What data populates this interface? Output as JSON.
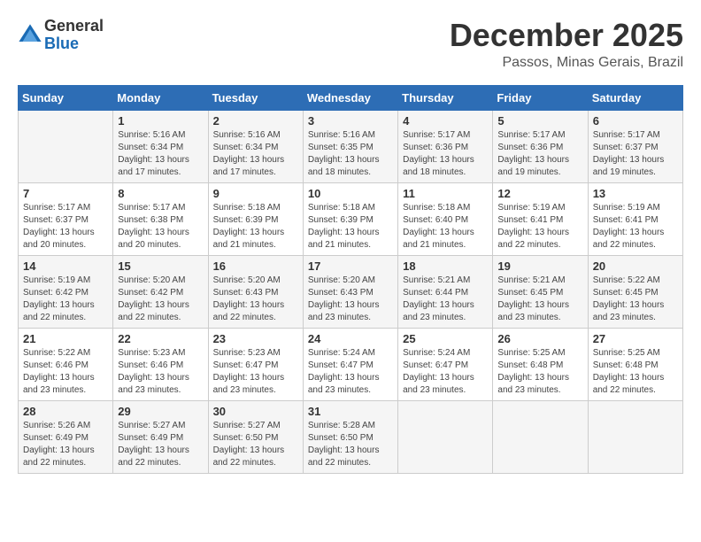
{
  "logo": {
    "general": "General",
    "blue": "Blue"
  },
  "title": "December 2025",
  "location": "Passos, Minas Gerais, Brazil",
  "days_of_week": [
    "Sunday",
    "Monday",
    "Tuesday",
    "Wednesday",
    "Thursday",
    "Friday",
    "Saturday"
  ],
  "weeks": [
    [
      {
        "day": "",
        "info": ""
      },
      {
        "day": "1",
        "info": "Sunrise: 5:16 AM\nSunset: 6:34 PM\nDaylight: 13 hours\nand 17 minutes."
      },
      {
        "day": "2",
        "info": "Sunrise: 5:16 AM\nSunset: 6:34 PM\nDaylight: 13 hours\nand 17 minutes."
      },
      {
        "day": "3",
        "info": "Sunrise: 5:16 AM\nSunset: 6:35 PM\nDaylight: 13 hours\nand 18 minutes."
      },
      {
        "day": "4",
        "info": "Sunrise: 5:17 AM\nSunset: 6:36 PM\nDaylight: 13 hours\nand 18 minutes."
      },
      {
        "day": "5",
        "info": "Sunrise: 5:17 AM\nSunset: 6:36 PM\nDaylight: 13 hours\nand 19 minutes."
      },
      {
        "day": "6",
        "info": "Sunrise: 5:17 AM\nSunset: 6:37 PM\nDaylight: 13 hours\nand 19 minutes."
      }
    ],
    [
      {
        "day": "7",
        "info": "Sunrise: 5:17 AM\nSunset: 6:37 PM\nDaylight: 13 hours\nand 20 minutes."
      },
      {
        "day": "8",
        "info": "Sunrise: 5:17 AM\nSunset: 6:38 PM\nDaylight: 13 hours\nand 20 minutes."
      },
      {
        "day": "9",
        "info": "Sunrise: 5:18 AM\nSunset: 6:39 PM\nDaylight: 13 hours\nand 21 minutes."
      },
      {
        "day": "10",
        "info": "Sunrise: 5:18 AM\nSunset: 6:39 PM\nDaylight: 13 hours\nand 21 minutes."
      },
      {
        "day": "11",
        "info": "Sunrise: 5:18 AM\nSunset: 6:40 PM\nDaylight: 13 hours\nand 21 minutes."
      },
      {
        "day": "12",
        "info": "Sunrise: 5:19 AM\nSunset: 6:41 PM\nDaylight: 13 hours\nand 22 minutes."
      },
      {
        "day": "13",
        "info": "Sunrise: 5:19 AM\nSunset: 6:41 PM\nDaylight: 13 hours\nand 22 minutes."
      }
    ],
    [
      {
        "day": "14",
        "info": "Sunrise: 5:19 AM\nSunset: 6:42 PM\nDaylight: 13 hours\nand 22 minutes."
      },
      {
        "day": "15",
        "info": "Sunrise: 5:20 AM\nSunset: 6:42 PM\nDaylight: 13 hours\nand 22 minutes."
      },
      {
        "day": "16",
        "info": "Sunrise: 5:20 AM\nSunset: 6:43 PM\nDaylight: 13 hours\nand 22 minutes."
      },
      {
        "day": "17",
        "info": "Sunrise: 5:20 AM\nSunset: 6:43 PM\nDaylight: 13 hours\nand 23 minutes."
      },
      {
        "day": "18",
        "info": "Sunrise: 5:21 AM\nSunset: 6:44 PM\nDaylight: 13 hours\nand 23 minutes."
      },
      {
        "day": "19",
        "info": "Sunrise: 5:21 AM\nSunset: 6:45 PM\nDaylight: 13 hours\nand 23 minutes."
      },
      {
        "day": "20",
        "info": "Sunrise: 5:22 AM\nSunset: 6:45 PM\nDaylight: 13 hours\nand 23 minutes."
      }
    ],
    [
      {
        "day": "21",
        "info": "Sunrise: 5:22 AM\nSunset: 6:46 PM\nDaylight: 13 hours\nand 23 minutes."
      },
      {
        "day": "22",
        "info": "Sunrise: 5:23 AM\nSunset: 6:46 PM\nDaylight: 13 hours\nand 23 minutes."
      },
      {
        "day": "23",
        "info": "Sunrise: 5:23 AM\nSunset: 6:47 PM\nDaylight: 13 hours\nand 23 minutes."
      },
      {
        "day": "24",
        "info": "Sunrise: 5:24 AM\nSunset: 6:47 PM\nDaylight: 13 hours\nand 23 minutes."
      },
      {
        "day": "25",
        "info": "Sunrise: 5:24 AM\nSunset: 6:47 PM\nDaylight: 13 hours\nand 23 minutes."
      },
      {
        "day": "26",
        "info": "Sunrise: 5:25 AM\nSunset: 6:48 PM\nDaylight: 13 hours\nand 23 minutes."
      },
      {
        "day": "27",
        "info": "Sunrise: 5:25 AM\nSunset: 6:48 PM\nDaylight: 13 hours\nand 22 minutes."
      }
    ],
    [
      {
        "day": "28",
        "info": "Sunrise: 5:26 AM\nSunset: 6:49 PM\nDaylight: 13 hours\nand 22 minutes."
      },
      {
        "day": "29",
        "info": "Sunrise: 5:27 AM\nSunset: 6:49 PM\nDaylight: 13 hours\nand 22 minutes."
      },
      {
        "day": "30",
        "info": "Sunrise: 5:27 AM\nSunset: 6:50 PM\nDaylight: 13 hours\nand 22 minutes."
      },
      {
        "day": "31",
        "info": "Sunrise: 5:28 AM\nSunset: 6:50 PM\nDaylight: 13 hours\nand 22 minutes."
      },
      {
        "day": "",
        "info": ""
      },
      {
        "day": "",
        "info": ""
      },
      {
        "day": "",
        "info": ""
      }
    ]
  ]
}
